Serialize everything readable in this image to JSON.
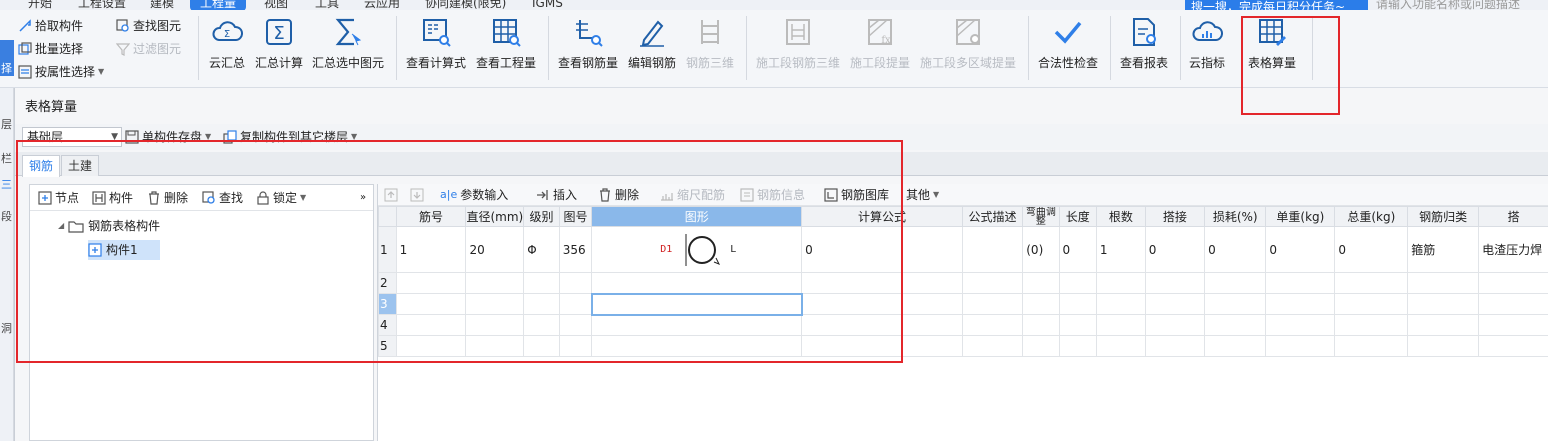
{
  "menu": {
    "items": [
      "开始",
      "工程设置",
      "建模",
      "工程量",
      "视图",
      "工具",
      "云应用",
      "协同建模(限免)",
      "IGMS"
    ],
    "active": "工程量"
  },
  "ribbon": {
    "left_strip_label": "择",
    "small_buttons": {
      "pick": "拾取构件",
      "batch": "批量选择",
      "by_attr": "按属性选择",
      "find": "查找图元",
      "filter": "过滤图元"
    },
    "big_buttons": {
      "cloud_sum": "云汇总",
      "sum_calc": "汇总计算",
      "sum_selected": "汇总选中图元",
      "view_formula": "查看计算式",
      "view_quantity": "查看工程量",
      "view_rebar": "查看钢筋量",
      "edit_rebar": "编辑钢筋",
      "rebar_3d": "钢筋三维",
      "stage_rebar_3d": "施工段钢筋三维",
      "stage_quantity": "施工段提量",
      "stage_multi": "施工段多区域提量",
      "legality": "合法性检查",
      "view_report": "查看报表",
      "cloud_index": "云指标",
      "table_calc": "表格算量"
    },
    "promo": "搜一搜，完成每日积分任务~",
    "search_placeholder": "请输入功能名称或问题描述"
  },
  "app_strip": [
    "层",
    "栏",
    "三",
    "段",
    "洞"
  ],
  "dialog": {
    "title": "表格算量",
    "floor": "基础层",
    "save_label": "单构件存盘",
    "copy_label": "复制构件到其它楼层",
    "tabs": [
      "钢筋",
      "土建"
    ],
    "active_tab": "钢筋",
    "tree_toolbar": [
      "节点",
      "构件",
      "删除",
      "查找",
      "锁定"
    ],
    "tree": {
      "root": "钢筋表格构件",
      "child": "构件1"
    },
    "grid_toolbar": {
      "up": "",
      "down": "",
      "param_input": "参数输入",
      "insert": "插入",
      "delete": "删除",
      "scale": "缩尺配筋",
      "rebar_info": "钢筋信息",
      "rebar_lib": "钢筋图库",
      "other": "其他"
    },
    "columns": [
      "筋号",
      "直径(mm)",
      "级别",
      "图号",
      "图形",
      "计算公式",
      "公式描述",
      "弯曲调整",
      "长度",
      "根数",
      "搭接",
      "损耗(%)",
      "单重(kg)",
      "总重(kg)",
      "钢筋归类",
      "搭"
    ],
    "rows": [
      {
        "num": "1",
        "cells": [
          "1",
          "20",
          "Φ",
          "356",
          "",
          "0",
          "",
          "(0)",
          "0",
          "1",
          "0",
          "0",
          "0",
          "0",
          "箍筋",
          "电渣压力焊"
        ]
      },
      {
        "num": "2",
        "cells": [
          "",
          "",
          "",
          "",
          "",
          "",
          "",
          "",
          "",
          "",
          "",
          "",
          "",
          "",
          "",
          ""
        ]
      },
      {
        "num": "3",
        "cells": [
          "",
          "",
          "",
          "",
          "",
          "",
          "",
          "",
          "",
          "",
          "",
          "",
          "",
          "",
          "",
          ""
        ]
      },
      {
        "num": "4",
        "cells": [
          "",
          "",
          "",
          "",
          "",
          "",
          "",
          "",
          "",
          "",
          "",
          "",
          "",
          "",
          "",
          ""
        ]
      },
      {
        "num": "5",
        "cells": [
          "",
          "",
          "",
          "",
          "",
          "",
          "",
          "",
          "",
          "",
          "",
          "",
          "",
          "",
          "",
          ""
        ]
      }
    ],
    "shape_labels": {
      "d": "D1",
      "l": "L"
    }
  },
  "colors": {
    "accent": "#2f7fe8",
    "highlight": "#e3262b"
  }
}
